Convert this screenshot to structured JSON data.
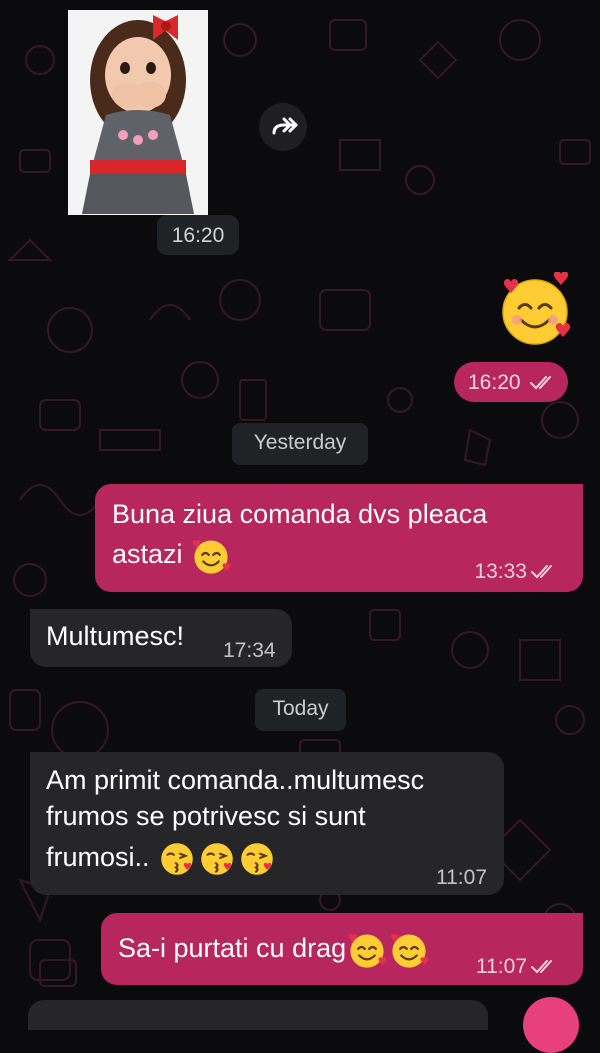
{
  "colors": {
    "background": "#0b0b0d",
    "outgoing_bubble": "#b7265d",
    "incoming_bubble": "#262628",
    "date_pill": "#1f2325",
    "wallpaper_doodle": "#3a1a26"
  },
  "messages": {
    "sticker_time": "16:20",
    "emoji_time": "16:20",
    "date_yesterday": "Yesterday",
    "msg1_line1": "Buna ziua comanda dvs pleaca",
    "msg1_line2": "astazi",
    "msg1_time": "13:33",
    "msg2_text": "Multumesc!",
    "msg2_time": "17:34",
    "date_today": "Today",
    "msg3_line1": "Am primit comanda..multumesc",
    "msg3_line2": "frumos se potrivesc si sunt",
    "msg3_line3": "frumosi..",
    "msg3_time": "11:07",
    "msg4_text": "Sa-i purtati cu drag",
    "msg4_time": "11:07"
  },
  "icons": {
    "forward": "forward-icon",
    "read_receipt": "double-check-icon",
    "smiling_hearts": "smiling-face-with-hearts-emoji",
    "kissing_heart": "face-blowing-kiss-emoji"
  }
}
